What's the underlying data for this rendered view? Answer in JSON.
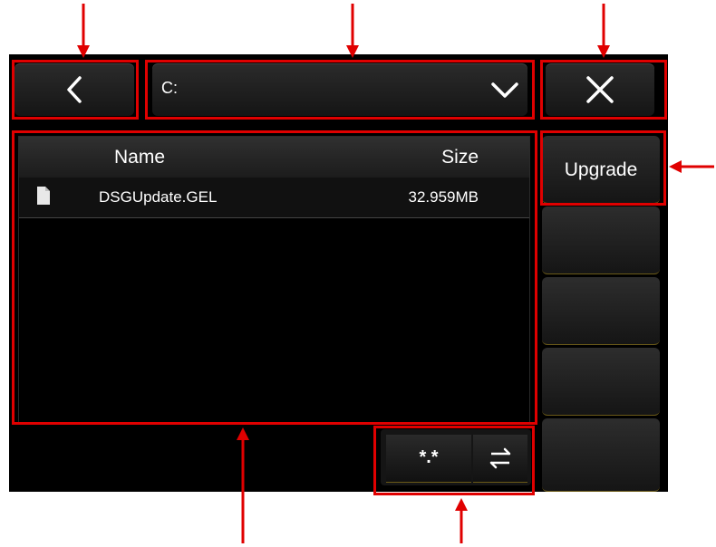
{
  "toolbar": {
    "back_icon": "chevron-left-icon",
    "drive": "C:",
    "drive_dropdown_icon": "chevron-down-icon",
    "close_icon": "close-icon"
  },
  "file_list": {
    "columns": [
      "Name",
      "Size"
    ],
    "rows": [
      {
        "name": "DSGUpdate.GEL",
        "size": "32.959MB",
        "icon": "file-icon"
      }
    ]
  },
  "side_panel": {
    "upgrade_label": "Upgrade"
  },
  "bottom_bar": {
    "filter_label": "*.*",
    "swap_icon": "swap-icon"
  },
  "colors": {
    "highlight": "#e00000",
    "background": "#000000",
    "accent": "#6b5a18"
  }
}
